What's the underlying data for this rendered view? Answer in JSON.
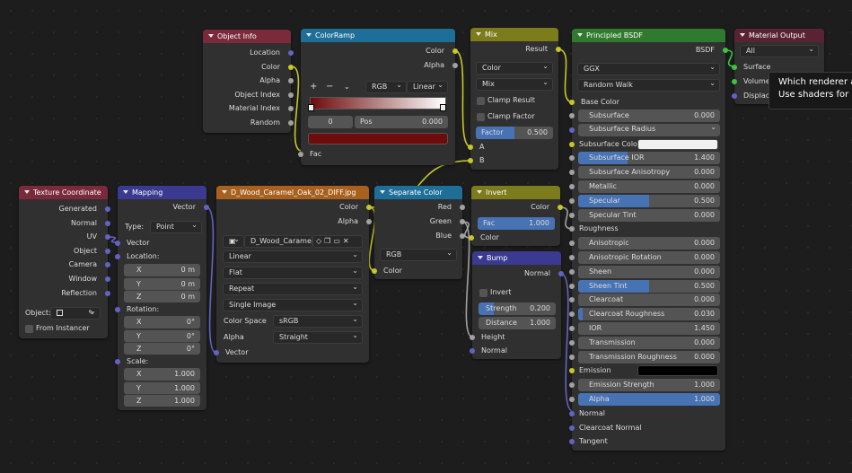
{
  "object_info": {
    "title": "Object Info",
    "outputs": [
      "Location",
      "Color",
      "Alpha",
      "Object Index",
      "Material Index",
      "Random"
    ]
  },
  "colorramp": {
    "title": "ColorRamp",
    "outputs": [
      "Color",
      "Alpha"
    ],
    "add": "+",
    "remove": "−",
    "menu": "⌄",
    "mode": "RGB",
    "interp": "Linear",
    "index": "0",
    "pos_label": "Pos",
    "pos_value": "0.000",
    "input": "Fac",
    "color_value": "#6e0b0b"
  },
  "mix": {
    "title": "Mix",
    "output": "Result",
    "type": "Color",
    "blend": "Mix",
    "clamp_result": "Clamp Result",
    "clamp_factor": "Clamp Factor",
    "factor_label": "Factor",
    "factor_value": "0.500",
    "factor_fraction": 0.5,
    "in_a": "A",
    "in_b": "B"
  },
  "bsdf": {
    "title": "Principled BSDF",
    "output": "BSDF",
    "distribution": "GGX",
    "subsurface_method": "Random Walk",
    "base_color": "Base Color",
    "rows": [
      {
        "label": "Subsurface",
        "value": "0.000",
        "fill": 0
      },
      {
        "label": "Subsurface Radius",
        "dropdown": true
      },
      {
        "label": "Subsurface Color",
        "color": "#f0f0f0"
      },
      {
        "label": "Subsurface IOR",
        "value": "1.400",
        "fill": 0.35
      },
      {
        "label": "Subsurface Anisotropy",
        "value": "0.000",
        "fill": 0
      },
      {
        "label": "Metallic",
        "value": "0.000",
        "fill": 0
      },
      {
        "label": "Specular",
        "value": "0.500",
        "fill": 0.5
      },
      {
        "label": "Specular Tint",
        "value": "0.000",
        "fill": 0
      },
      {
        "label": "Roughness",
        "socket_only": true
      },
      {
        "label": "Anisotropic",
        "value": "0.000",
        "fill": 0
      },
      {
        "label": "Anisotropic Rotation",
        "value": "0.000",
        "fill": 0
      },
      {
        "label": "Sheen",
        "value": "0.000",
        "fill": 0
      },
      {
        "label": "Sheen Tint",
        "value": "0.500",
        "fill": 0.5
      },
      {
        "label": "Clearcoat",
        "value": "0.000",
        "fill": 0
      },
      {
        "label": "Clearcoat Roughness",
        "value": "0.030",
        "fill": 0.03
      },
      {
        "label": "IOR",
        "value": "1.450",
        "fill": 0
      },
      {
        "label": "Transmission",
        "value": "0.000",
        "fill": 0
      },
      {
        "label": "Transmission Roughness",
        "value": "0.000",
        "fill": 0
      },
      {
        "label": "Emission",
        "color": "#000000"
      },
      {
        "label": "Emission Strength",
        "value": "1.000",
        "fill": 0
      },
      {
        "label": "Alpha",
        "value": "1.000",
        "fill": 1
      },
      {
        "label": "Normal",
        "socket_only": true
      },
      {
        "label": "Clearcoat Normal",
        "socket_only": true
      },
      {
        "label": "Tangent",
        "socket_only": true
      }
    ]
  },
  "material_output": {
    "title": "Material Output",
    "target": "All",
    "inputs": [
      "Surface",
      "Volume",
      "Displace"
    ]
  },
  "tooltip": {
    "line1": "Which renderer a",
    "line2": "Use shaders for a"
  },
  "texcoord": {
    "title": "Texture Coordinate",
    "outputs": [
      "Generated",
      "Normal",
      "UV",
      "Object",
      "Camera",
      "Window",
      "Reflection"
    ],
    "object_label": "Object:",
    "from_instancer": "From Instancer"
  },
  "mapping": {
    "title": "Mapping",
    "output": "Vector",
    "type_label": "Type:",
    "type_value": "Point",
    "vector": "Vector",
    "location": "Location:",
    "rotation": "Rotation:",
    "scale": "Scale:",
    "loc": [
      {
        "axis": "X",
        "value": "0 m"
      },
      {
        "axis": "Y",
        "value": "0 m"
      },
      {
        "axis": "Z",
        "value": "0 m"
      }
    ],
    "rot": [
      {
        "axis": "X",
        "value": "0°"
      },
      {
        "axis": "Y",
        "value": "0°"
      },
      {
        "axis": "Z",
        "value": "0°"
      }
    ],
    "scl": [
      {
        "axis": "X",
        "value": "1.000"
      },
      {
        "axis": "Y",
        "value": "1.000"
      },
      {
        "axis": "Z",
        "value": "1.000"
      }
    ]
  },
  "image": {
    "title": "D_Wood_Caramel_Oak_02_DIFF.jpg",
    "outputs": [
      "Color",
      "Alpha"
    ],
    "image_name": "D_Wood_Caramel...",
    "interpolation": "Linear",
    "projection": "Flat",
    "extension": "Repeat",
    "source": "Single Image",
    "colorspace_label": "Color Space",
    "colorspace": "sRGB",
    "alpha_label": "Alpha",
    "alpha": "Straight",
    "input": "Vector"
  },
  "separate": {
    "title": "Separate Color",
    "outputs": [
      "Red",
      "Green",
      "Blue"
    ],
    "mode": "RGB",
    "input": "Color"
  },
  "invert": {
    "title": "Invert",
    "output": "Color",
    "fac_label": "Fac",
    "fac_value": "1.000",
    "fac_fraction": 1,
    "input": "Color"
  },
  "bump": {
    "title": "Bump",
    "output": "Normal",
    "invert": "Invert",
    "strength_label": "Strength",
    "strength_value": "0.200",
    "strength_fraction": 0.2,
    "distance_label": "Distance",
    "distance_value": "1.000",
    "inputs": [
      "Height",
      "Normal"
    ]
  }
}
